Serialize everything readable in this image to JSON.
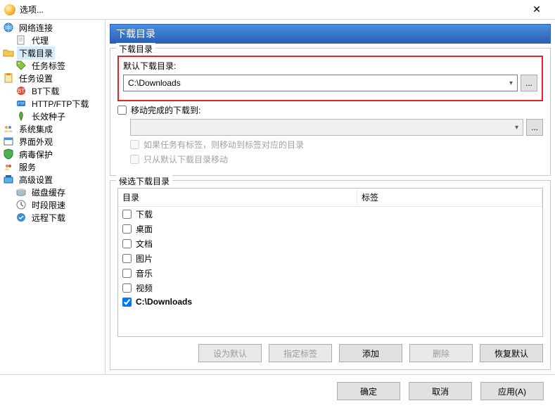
{
  "window": {
    "title": "选项...",
    "close": "✕"
  },
  "tree": [
    {
      "icon": "globe-icon",
      "label": "网络连接",
      "depth": 0
    },
    {
      "icon": "doc-icon",
      "label": "代理",
      "depth": 1
    },
    {
      "icon": "folder-open-icon",
      "label": "下载目录",
      "depth": 0,
      "selected": true
    },
    {
      "icon": "tag-icon",
      "label": "任务标签",
      "depth": 1
    },
    {
      "icon": "clipboard-icon",
      "label": "任务设置",
      "depth": 0
    },
    {
      "icon": "bt-icon",
      "label": "BT下载",
      "depth": 1
    },
    {
      "icon": "http-icon",
      "label": "HTTP/FTP下载",
      "depth": 1
    },
    {
      "icon": "seed-icon",
      "label": "长效种子",
      "depth": 1
    },
    {
      "icon": "users-icon",
      "label": "系统集成",
      "depth": 0
    },
    {
      "icon": "window-icon",
      "label": "界面外观",
      "depth": 0
    },
    {
      "icon": "shield-icon",
      "label": "病毒保护",
      "depth": 0
    },
    {
      "icon": "service-icon",
      "label": "服务",
      "depth": 0
    },
    {
      "icon": "adv-icon",
      "label": "高级设置",
      "depth": 0
    },
    {
      "icon": "disk-icon",
      "label": "磁盘缓存",
      "depth": 1
    },
    {
      "icon": "clock-icon",
      "label": "时段限速",
      "depth": 1
    },
    {
      "icon": "remote-icon",
      "label": "远程下载",
      "depth": 1
    }
  ],
  "panel": {
    "title": "下载目录",
    "section_download": "下载目录",
    "default_dir": {
      "label": "默认下载目录:",
      "value": "C:\\Downloads",
      "browse": "..."
    },
    "move_done": {
      "label": "移动完成的下载到:",
      "checked": false,
      "browse": "..."
    },
    "move_by_tag": "如果任务有标签，则移动到标签对应的目录",
    "move_from_default": "只从默认下载目录移动",
    "section_candidate": "候选下载目录",
    "table": {
      "col_dir": "目录",
      "col_tag": "标签",
      "rows": [
        {
          "label": "下载",
          "checked": false
        },
        {
          "label": "桌面",
          "checked": false
        },
        {
          "label": "文档",
          "checked": false
        },
        {
          "label": "图片",
          "checked": false
        },
        {
          "label": "音乐",
          "checked": false
        },
        {
          "label": "视频",
          "checked": false
        },
        {
          "label": "C:\\Downloads",
          "checked": true,
          "bold": true
        }
      ]
    },
    "buttons": {
      "set_default": "设为默认",
      "set_tag": "指定标签",
      "add": "添加",
      "delete": "删除",
      "restore": "恢复默认"
    }
  },
  "footer": {
    "ok": "确定",
    "cancel": "取消",
    "apply": "应用(A)"
  }
}
